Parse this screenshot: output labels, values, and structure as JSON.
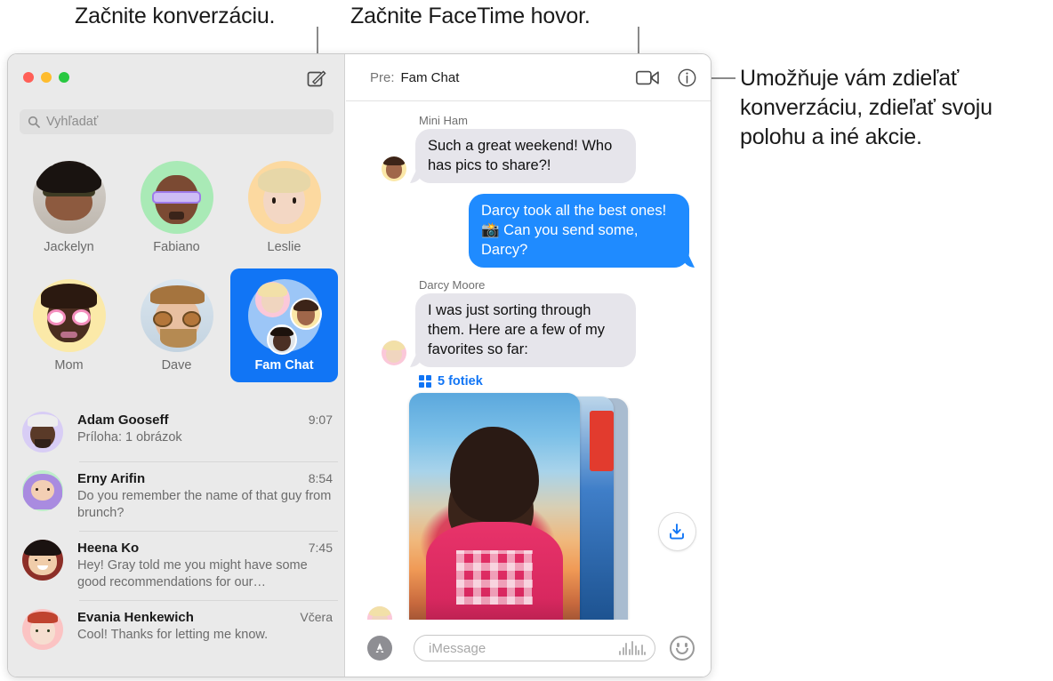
{
  "callouts": [
    {
      "name": "compose-callout",
      "text": "Začnite konverzáciu."
    },
    {
      "name": "facetime-callout",
      "text": "Začnite FaceTime hovor."
    },
    {
      "name": "details-callout",
      "text": "Umožňuje vám zdieľať konverzáciu, zdieľať svoju polohu a iné akcie."
    }
  ],
  "window": {
    "traffic_lights": [
      {
        "name": "close",
        "color": "#ff5f57"
      },
      {
        "name": "minimize",
        "color": "#febc2e"
      },
      {
        "name": "zoom",
        "color": "#28c840"
      }
    ]
  },
  "sidebar": {
    "compose_icon": "compose-icon",
    "search": {
      "placeholder": "Vyhľadať",
      "icon": "search-icon"
    },
    "pinned": [
      {
        "name": "Jackelyn",
        "selected": false
      },
      {
        "name": "Fabiano",
        "selected": false
      },
      {
        "name": "Leslie",
        "selected": false
      },
      {
        "name": "Mom",
        "selected": false
      },
      {
        "name": "Dave",
        "selected": false
      },
      {
        "name": "Fam Chat",
        "selected": true
      }
    ],
    "conversations": [
      {
        "name": "Adam Gooseff",
        "time": "9:07",
        "preview": "Príloha:  1 obrázok"
      },
      {
        "name": "Erny Arifin",
        "time": "8:54",
        "preview": "Do you remember the name of that guy from brunch?"
      },
      {
        "name": "Heena Ko",
        "time": "7:45",
        "preview": "Hey! Gray told me you might have some good recommendations for our…"
      },
      {
        "name": "Evania Henkewich",
        "time": "Včera",
        "preview": "Cool! Thanks for letting me know."
      }
    ]
  },
  "chat": {
    "to_label": "Pre:",
    "to_value": "Fam Chat",
    "facetime_icon": "video-camera-icon",
    "details_icon": "info-circle-icon",
    "messages": [
      {
        "sender": "Mini Ham",
        "text": "Such a great weekend! Who has pics to share?!",
        "direction": "in"
      },
      {
        "sender": "",
        "text": "Darcy took all the best ones! 📸 Can you send some, Darcy?",
        "direction": "out"
      },
      {
        "sender": "Darcy Moore",
        "text": "I was just sorting through them. Here are a few of my favorites so far:",
        "direction": "in"
      }
    ],
    "attachment": {
      "count_label": "5 fotiek",
      "grid_icon": "grid-icon",
      "download_icon": "download-icon"
    },
    "input": {
      "apps_icon": "app-store-icon",
      "placeholder": "iMessage",
      "audio_icon": "audio-waveform-icon",
      "emoji_icon": "smiley-icon"
    }
  },
  "colors": {
    "accent_blue": "#1175f5",
    "bubble_out": "#1f8bff",
    "bubble_in": "#e6e5eb",
    "sidebar_bg": "#eaeaea"
  }
}
